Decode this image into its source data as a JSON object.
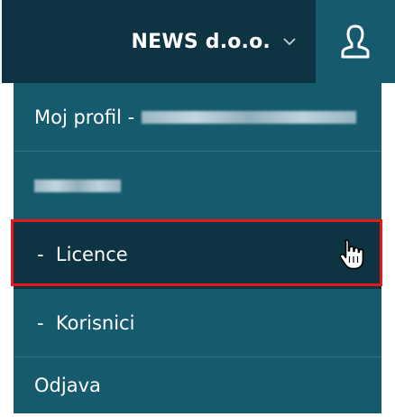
{
  "header": {
    "company_name": "NEWS d.o.o.",
    "company_dropdown_icon": "chevron-down-icon",
    "user_icon": "user-icon"
  },
  "menu": {
    "profile_label": "Moj profil -",
    "licence_label": "-  Licence",
    "korisnici_label": "-  Korisnici",
    "logout_label": "Odjava"
  },
  "colors": {
    "dark_navy": "#0e3444",
    "menu_teal": "#165a6e",
    "highlight_red": "#e81818"
  }
}
